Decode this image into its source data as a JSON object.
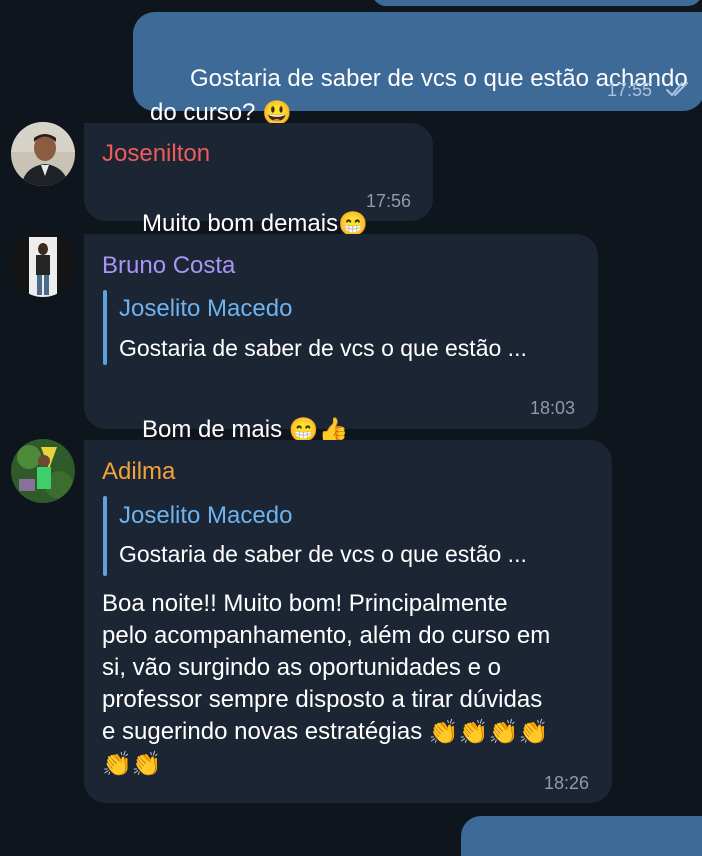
{
  "messages": [
    {
      "id": "m1",
      "direction": "outgoing",
      "text": "Gostaria de saber de vcs o que estão achando do curso?",
      "emoji": "😃",
      "time": "17:55",
      "status": "read"
    },
    {
      "id": "m2",
      "direction": "incoming",
      "sender": "Josenilton",
      "sender_color": "#ef5b5b",
      "text": "Muito bom demais",
      "emoji": "😁",
      "time": "17:56"
    },
    {
      "id": "m3",
      "direction": "incoming",
      "sender": "Bruno Costa",
      "sender_color": "#a995f5",
      "reply_name": "Joselito Macedo",
      "reply_text": "Gostaria de saber de vcs o que estão ...",
      "text": "Bom de mais",
      "emoji": "😁👍",
      "time": "18:03"
    },
    {
      "id": "m4",
      "direction": "incoming",
      "sender": "Adilma",
      "sender_color": "#f2a23b",
      "reply_name": "Joselito Macedo",
      "reply_text": "Gostaria de saber de vcs o que estão ...",
      "text_lines": [
        "Boa noite!! Muito bom! Principalmente",
        "pelo acompanhamento, além do curso em",
        "si, vão surgindo as oportunidades e o",
        "professor sempre disposto a tirar dúvidas",
        "e sugerindo novas estratégias"
      ],
      "emoji_line_end": "👏👏👏👏",
      "emoji_line2": "👏👏",
      "time": "18:26"
    }
  ],
  "colors": {
    "background": "#0f151d",
    "incoming_bubble": "#1c2533",
    "outgoing_bubble": "#3d6a97",
    "reply_accent": "#6db3ef",
    "time_gray": "#8d9aa9"
  }
}
